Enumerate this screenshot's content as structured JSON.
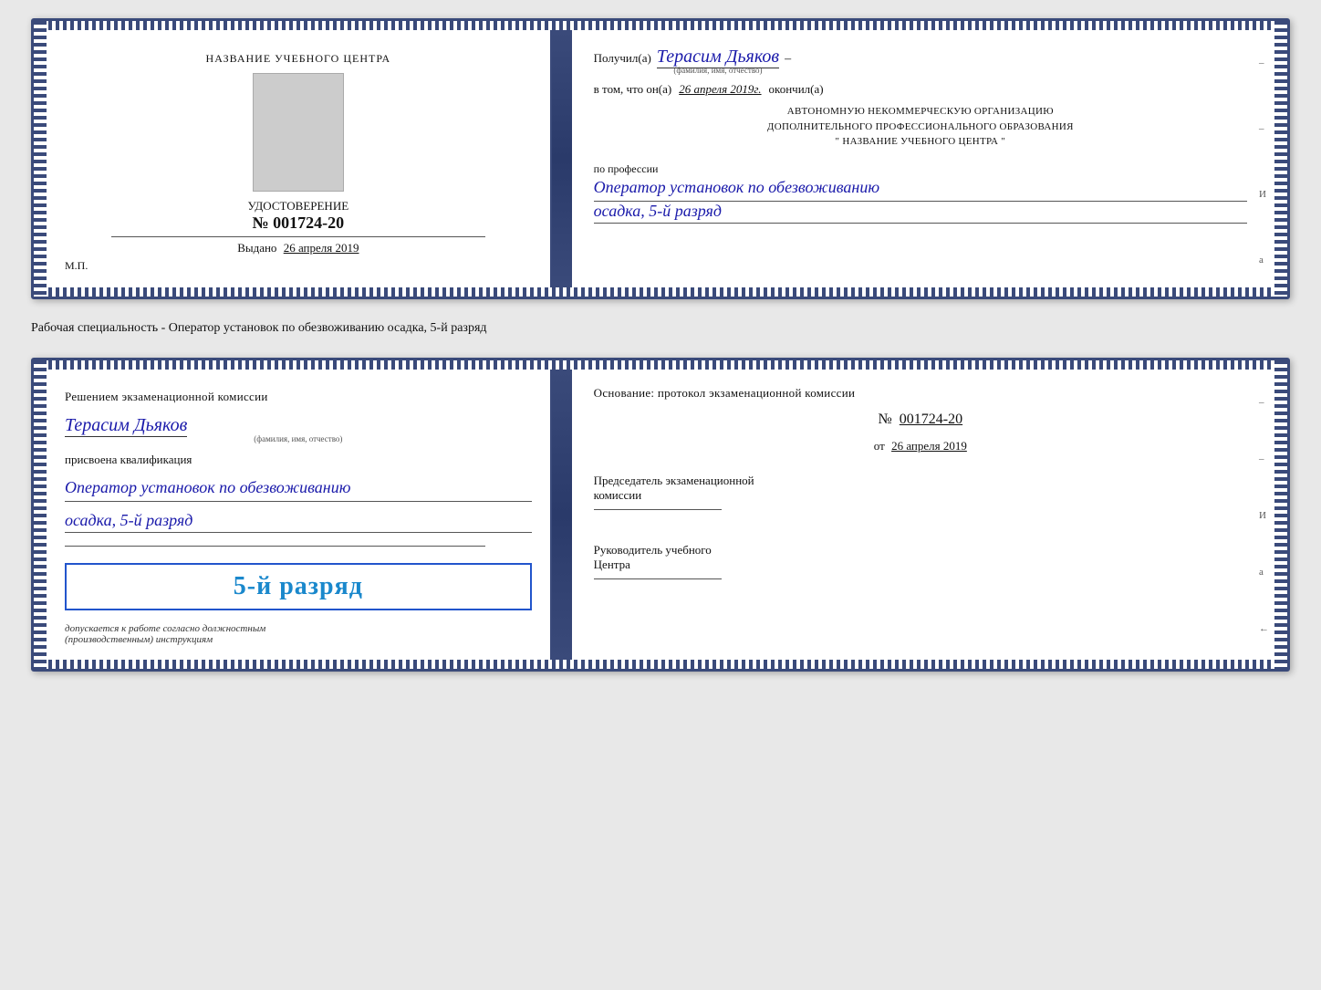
{
  "cert1": {
    "left": {
      "training_center_label": "НАЗВАНИЕ УЧЕБНОГО ЦЕНТРА",
      "doc_type": "УДОСТОВЕРЕНИЕ",
      "doc_number_prefix": "№",
      "doc_number": "001724-20",
      "issued_label": "Выдано",
      "issued_date": "26 апреля 2019",
      "mp_label": "М.П."
    },
    "right": {
      "received_label": "Получил(а)",
      "recipient_name": "Терасим Дьяков",
      "name_sub": "(фамилия, имя, отчество)",
      "dash": "–",
      "date_intro": "в том, что он(а)",
      "date_value": "26 апреля 2019г.",
      "completed_label": "окончил(а)",
      "org_line1": "АВТОНОМНУЮ НЕКОММЕРЧЕСКУЮ ОРГАНИЗАЦИЮ",
      "org_line2": "ДОПОЛНИТЕЛЬНОГО ПРОФЕССИОНАЛЬНОГО ОБРАЗОВАНИЯ",
      "org_name": "\" НАЗВАНИЕ УЧЕБНОГО ЦЕНТРА \"",
      "profession_label": "по профессии",
      "profession_value": "Оператор установок по обезвоживанию",
      "profession_value2": "осадка, 5-й разряд"
    }
  },
  "separator": {
    "text": "Рабочая специальность - Оператор установок по обезвоживанию осадка, 5-й разряд"
  },
  "cert2": {
    "left": {
      "title": "Решением экзаменационной комиссии",
      "person_name": "Терасим Дьяков",
      "name_sub": "(фамилия, имя, отчество)",
      "qualified_label": "присвоена квалификация",
      "qualification1": "Оператор установок по обезвоживанию",
      "qualification2": "осадка, 5-й разряд",
      "stamp_rank": "5-й разряд",
      "stamp_sub": "допускается к работе согласно должностным",
      "stamp_sub2": "(производственным) инструкциям"
    },
    "right": {
      "basis_label": "Основание: протокол экзаменационной комиссии",
      "protocol_prefix": "№",
      "protocol_number": "001724-20",
      "date_prefix": "от",
      "date_value": "26 апреля 2019",
      "chairman_label": "Председатель экзаменационной",
      "chairman_label2": "комиссии",
      "director_label": "Руководитель учебного",
      "director_label2": "Центра"
    }
  },
  "side_marks": {
    "top": "И",
    "mid": "а",
    "bottom": "←"
  }
}
